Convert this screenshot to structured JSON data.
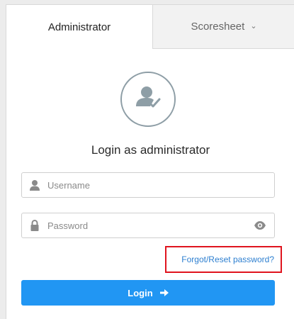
{
  "tabs": {
    "administrator": "Administrator",
    "scoresheet": "Scoresheet",
    "scoresheet_chevron": "⌄"
  },
  "avatar": {
    "icon": "user-check-icon"
  },
  "login": {
    "title": "Login as administrator",
    "username_placeholder": "Username",
    "password_placeholder": "Password",
    "forgot_link": "Forgot/Reset password?",
    "button_label": "Login"
  },
  "colors": {
    "primary": "#2196f3",
    "link": "#2d7fd0",
    "highlight_box": "#e0141e",
    "icon_gray": "#8e9ea6"
  }
}
